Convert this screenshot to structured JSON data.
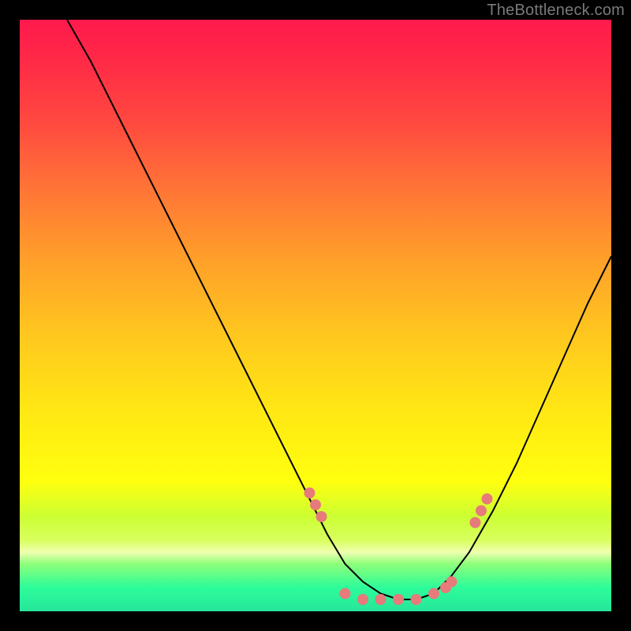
{
  "watermark": "TheBottleneck.com",
  "chart_data": {
    "type": "line",
    "title": "",
    "xlabel": "",
    "ylabel": "",
    "xlim": [
      0,
      100
    ],
    "ylim": [
      0,
      100
    ],
    "curve": {
      "name": "bottleneck-curve",
      "x": [
        8,
        12,
        16,
        20,
        24,
        28,
        32,
        36,
        40,
        44,
        48,
        52,
        55,
        58,
        61,
        64,
        67,
        70,
        73,
        76,
        80,
        84,
        88,
        92,
        96,
        100
      ],
      "y": [
        100,
        93,
        85,
        77,
        69,
        61,
        53,
        45,
        37,
        29,
        21,
        13,
        8,
        5,
        3,
        2,
        2,
        3,
        6,
        10,
        17,
        25,
        34,
        43,
        52,
        60
      ]
    },
    "markers": {
      "name": "highlight-dots",
      "color": "#e77a7a",
      "x": [
        49,
        50,
        51,
        55,
        58,
        61,
        64,
        67,
        70,
        72,
        73,
        77,
        78,
        79
      ],
      "y": [
        20,
        18,
        16,
        3,
        2,
        2,
        2,
        2,
        3,
        4,
        5,
        15,
        17,
        19
      ]
    }
  }
}
